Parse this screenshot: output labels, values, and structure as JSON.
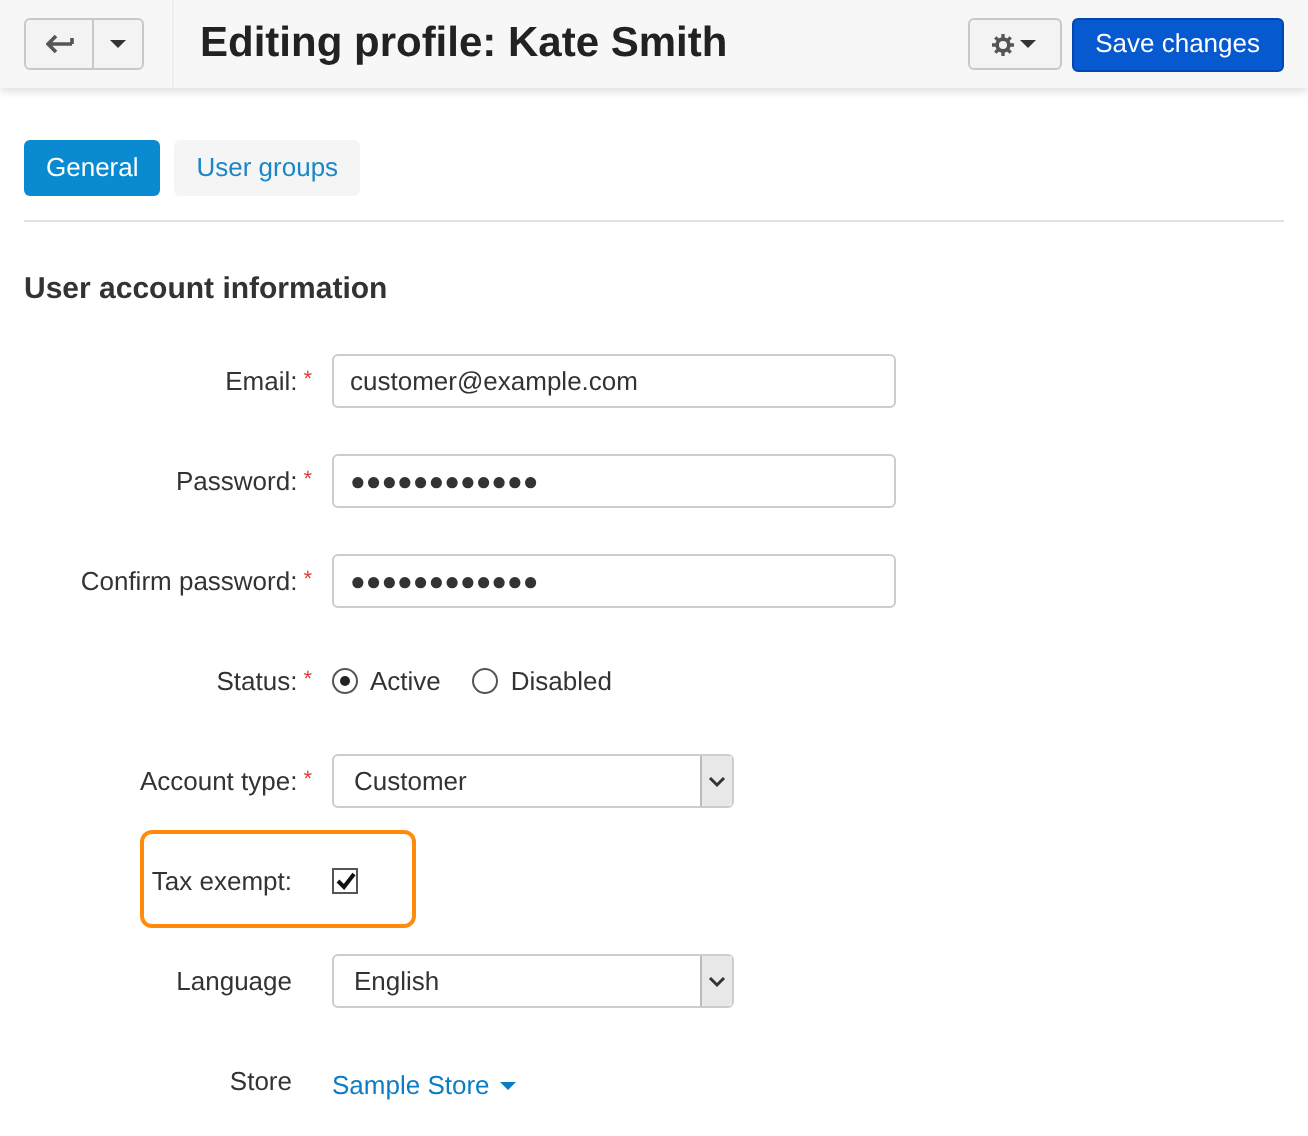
{
  "header": {
    "title": "Editing profile: Kate Smith",
    "save_button": "Save changes"
  },
  "tabs": [
    {
      "label": "General",
      "selected": true
    },
    {
      "label": "User groups",
      "selected": false
    }
  ],
  "section_title": "User account information",
  "fields": [
    {
      "kind": "text",
      "label": "Email:",
      "required_mark": "*",
      "value": "customer@example.com"
    },
    {
      "kind": "text",
      "label": "Password:",
      "required_mark": "*",
      "value": "●●●●●●●●●●●●"
    },
    {
      "kind": "text",
      "label": "Confirm password:",
      "required_mark": "*",
      "value": "●●●●●●●●●●●●"
    },
    {
      "kind": "radio",
      "label": "Status:",
      "required_mark": "*",
      "options": [
        {
          "label": "Active",
          "selected": true
        },
        {
          "label": "Disabled",
          "selected": false
        }
      ]
    },
    {
      "kind": "select",
      "label": "Account type:",
      "required_mark": "*",
      "value": "Customer"
    },
    {
      "kind": "checkbox",
      "label": "Tax exempt:",
      "checked": true,
      "highlighted": true
    },
    {
      "kind": "select",
      "label": "Language",
      "value": "English"
    },
    {
      "kind": "link",
      "label": "Store",
      "value": "Sample Store"
    }
  ]
}
